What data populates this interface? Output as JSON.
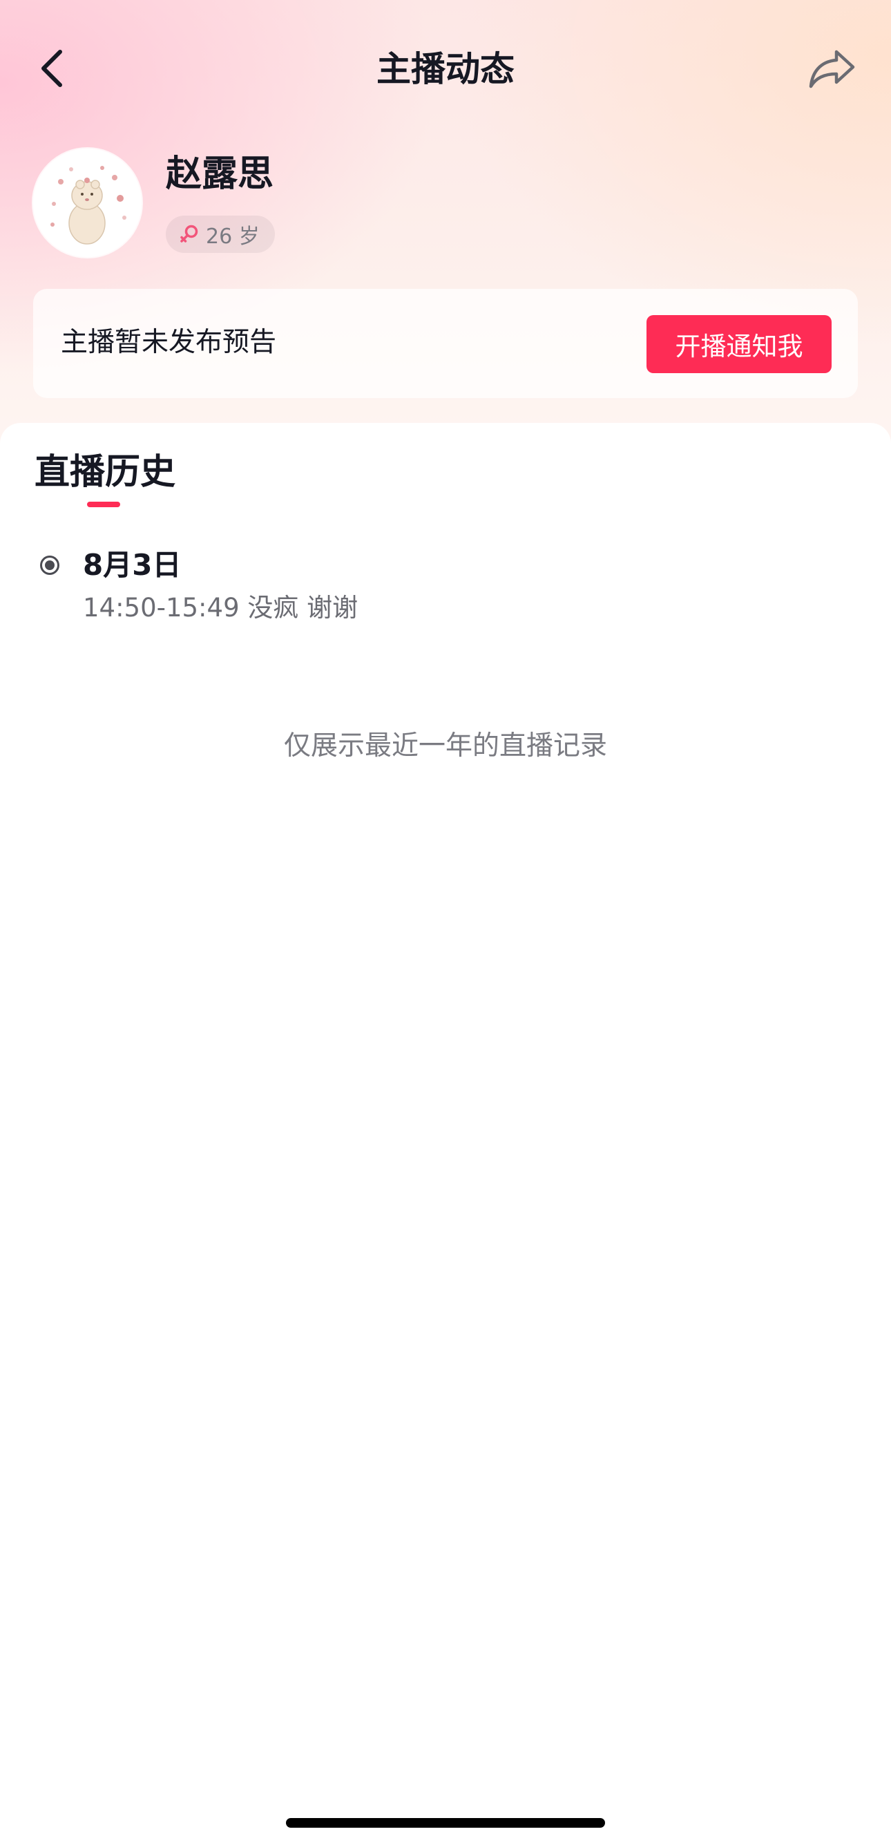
{
  "header": {
    "title": "主播动态",
    "back_icon": "chevron-left-icon",
    "share_icon": "share-arrow-icon"
  },
  "profile": {
    "name": "赵露思",
    "age": "26 岁",
    "gender_icon": "female-icon"
  },
  "notice": {
    "text": "主播暂未发布预告",
    "button_label": "开播通知我"
  },
  "history": {
    "title": "直播历史",
    "items": [
      {
        "date": "8月3日",
        "detail": "14:50-15:49 没疯 谢谢"
      }
    ],
    "footer_note": "仅展示最近一年的直播记录"
  },
  "colors": {
    "accent": "#fe2c55",
    "text_primary": "#161823",
    "text_secondary": "#6b6c73"
  }
}
